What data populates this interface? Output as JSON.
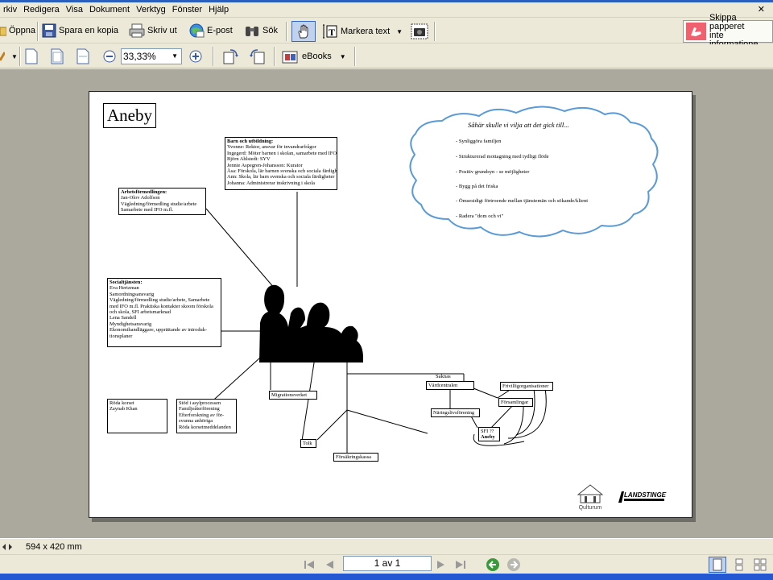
{
  "menu": [
    "rkiv",
    "Redigera",
    "Visa",
    "Dokument",
    "Verktyg",
    "Fönster",
    "Hjälp"
  ],
  "toolbar": {
    "open": "Öppna",
    "save_copy": "Spara en kopia",
    "print": "Skriv ut",
    "email": "E-post",
    "search": "Sök",
    "select_text": "Markera text",
    "ebooks": "eBooks",
    "zoom": "33,33%",
    "skip_line1": "Skippa papperet",
    "skip_line2": "inte informatione"
  },
  "status": {
    "page_size": "594 x 420 mm"
  },
  "nav": {
    "page_indicator": "1 av 1"
  },
  "document": {
    "title": "Aneby",
    "barn": {
      "heading": "Barn och utbildning:",
      "lines": [
        "Yvonne: Rektor, ansvar för invandrarfrågor",
        "Ingegerd: Möter barnen i skolan, samarbete med IFO",
        "Björn Ahlstedt: SYV",
        "Jennie Aspegren-Johansson: Kurator",
        "Åsa: Förskola, lär barnen svenska och sociala färdigheter",
        "Ann: Skola, lär barn svenska och sociala färdigheter",
        "Johanna: Administrerar inskrivning i skola"
      ]
    },
    "arbets": {
      "heading": "Arbetsförmedlingen:",
      "lines": [
        "Jan-Olov Adolfson",
        "Vägledning/förmedling studie/arbete",
        "Samarbete med IFO m.fl."
      ]
    },
    "social": {
      "heading": "Socialtjänsten:",
      "lines": [
        "Eva Hertzman",
        "Samordningsansvarig",
        "Vägledning/förmedling studie/arbete, Samarbete",
        "med IFO m.fl. Praktiska kontakter skoom förskola",
        "och skola, SFI arbetsmarknad",
        "Lena Sandell",
        "Myndighetsansvarig",
        "Ekonomihandläggare, upprättande av introduk-",
        "tionsplaner"
      ]
    },
    "roda_korset": {
      "lines": [
        "Röda korset",
        "Zaynab Khan"
      ]
    },
    "stod": {
      "lines": [
        "Stöd i asylprocessen",
        "Familjeåterförening",
        "Efterforskning av för-",
        "svunna anhöriga",
        "Röda korsetmeddelanden"
      ]
    },
    "migration": "Migrationsverket",
    "tolk": "Tolk",
    "forsakring": "Försäkringskassa",
    "saknas": "Saknas",
    "vardcentral": "Vårdcentralen",
    "naringsliv": "Näringslivsförening",
    "frivillig": "Frivilligorganisationer",
    "forsamlingar": "Församlingar",
    "sfi": [
      "SFI ??",
      "Aneby"
    ],
    "cloud": {
      "heading": "Såhär skulle vi vilja att det gick till...",
      "items": [
        "- Synliggöra familjen",
        "- Strukturerad mottagning med tydligt flöde",
        "- Positiv grundsyn - se möjligheter",
        "- Bygg på det friska",
        "- Ömsesidigt förtroende mellan tjänstemän och sökande/klient",
        "- Radera \"dom och vi\""
      ]
    },
    "logo_qulturum": "Qulturum",
    "logo_landstinget": "LANDSTINGET"
  },
  "colors": {
    "selected_tool": "#c1d2ee",
    "cloud_stroke": "#5a9ad6",
    "titlebar": "#2b5fbe"
  }
}
